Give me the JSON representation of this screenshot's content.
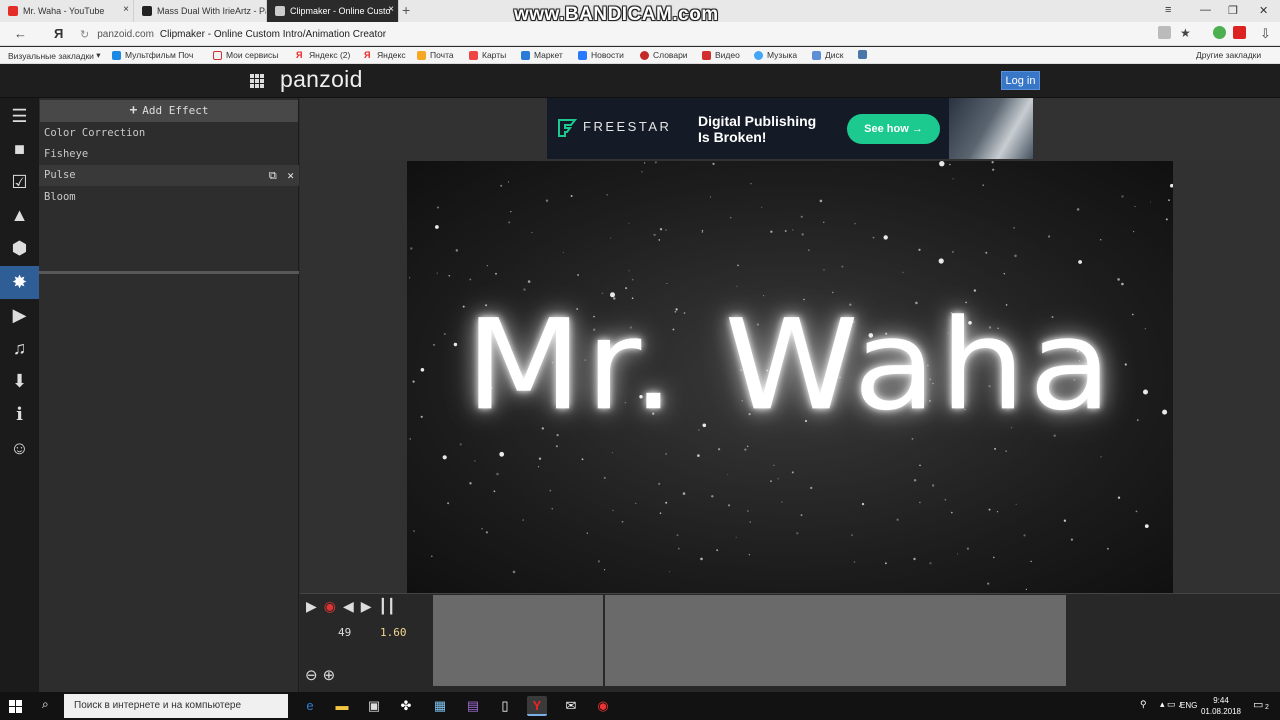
{
  "browser": {
    "tabs": [
      {
        "title": "Mr. Waha - YouTube",
        "color": "#e52d27"
      },
      {
        "title": "Mass Dual With IrieArtz - Pa",
        "color": "#222222"
      },
      {
        "title": "Clipmaker - Online Custo",
        "color": "#222222",
        "active": true
      }
    ],
    "watermark": "www.BANDICAM.com",
    "url_domain": "panzoid.com",
    "url_title": "Clipmaker - Online Custom Intro/Animation Creator",
    "bookmarks": [
      "Визуальные закладки",
      "Мультфильм Поч",
      "Мои сервисы",
      "Яндекс (2)",
      "Яндекс",
      "Почта",
      "Карты",
      "Маркет",
      "Новости",
      "Словари",
      "Видео",
      "Музыка",
      "Диск"
    ],
    "other_bookmarks": "Другие закладки"
  },
  "app": {
    "logo": "panzoid",
    "login_label": "Log in",
    "add_effect_label": "Add Effect",
    "effects": [
      "Color Correction",
      "Fisheye",
      "Pulse",
      "Bloom"
    ],
    "selected_effect": "Pulse",
    "canvas_text": "Mr. Waha",
    "timeline": {
      "frame": "49",
      "time": "1.60"
    }
  },
  "ad": {
    "brand": "FREESTAR",
    "headline_line1": "Digital Publishing",
    "headline_line2": "Is Broken!",
    "cta": "See how",
    "accent": "#1cc98e"
  },
  "taskbar": {
    "search_placeholder": "Поиск в интернете и на компьютере",
    "lang": "ENG",
    "time": "9:44",
    "date": "01.08.2018",
    "notifications": "2"
  },
  "colors": {
    "active_rail": "#2f5e97",
    "login_button": "#3876c8"
  }
}
